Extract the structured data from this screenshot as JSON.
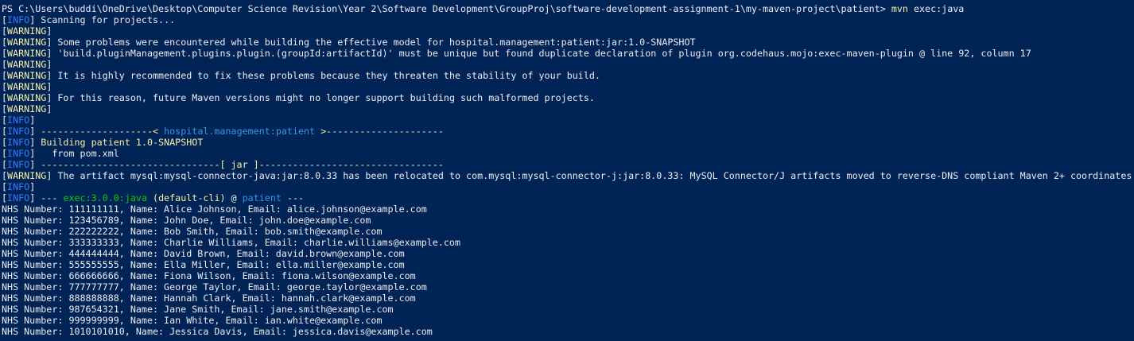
{
  "colors": {
    "background": "#012456",
    "default": "#eeedf0",
    "warning": "#f9f1a5",
    "info": "#3b78ff",
    "cyan": "#3a96dd",
    "green": "#16c60c"
  },
  "lines": [
    [
      {
        "t": "PS C:\\Users\\buddi\\OneDrive\\Desktop\\Computer Science Revision\\Year 2\\Software Development\\GroupProj\\software-development-assignment-1\\my-maven-project\\patient> ",
        "c": "default"
      },
      {
        "t": "mvn",
        "c": "yellow"
      },
      {
        "t": " exec:java",
        "c": "default"
      }
    ],
    [
      {
        "t": "[",
        "c": "default"
      },
      {
        "t": "INFO",
        "c": "info"
      },
      {
        "t": "] Scanning for projects...",
        "c": "default"
      }
    ],
    [
      {
        "t": "[",
        "c": "default"
      },
      {
        "t": "WARNING",
        "c": "warn"
      },
      {
        "t": "]",
        "c": "default"
      }
    ],
    [
      {
        "t": "[",
        "c": "default"
      },
      {
        "t": "WARNING",
        "c": "warn"
      },
      {
        "t": "] Some problems were encountered while building the effective model for hospital.management:patient:jar:1.0-SNAPSHOT",
        "c": "default"
      }
    ],
    [
      {
        "t": "[",
        "c": "default"
      },
      {
        "t": "WARNING",
        "c": "warn"
      },
      {
        "t": "] 'build.pluginManagement.plugins.plugin.(groupId:artifactId)' must be unique but found duplicate declaration of plugin org.codehaus.mojo:exec-maven-plugin @ line 92, column 17",
        "c": "default"
      }
    ],
    [
      {
        "t": "[",
        "c": "default"
      },
      {
        "t": "WARNING",
        "c": "warn"
      },
      {
        "t": "]",
        "c": "default"
      }
    ],
    [
      {
        "t": "[",
        "c": "default"
      },
      {
        "t": "WARNING",
        "c": "warn"
      },
      {
        "t": "] It is highly recommended to fix these problems because they threaten the stability of your build.",
        "c": "default"
      }
    ],
    [
      {
        "t": "[",
        "c": "default"
      },
      {
        "t": "WARNING",
        "c": "warn"
      },
      {
        "t": "]",
        "c": "default"
      }
    ],
    [
      {
        "t": "[",
        "c": "default"
      },
      {
        "t": "WARNING",
        "c": "warn"
      },
      {
        "t": "] For this reason, future Maven versions might no longer support building such malformed projects.",
        "c": "default"
      }
    ],
    [
      {
        "t": "[",
        "c": "default"
      },
      {
        "t": "WARNING",
        "c": "warn"
      },
      {
        "t": "]",
        "c": "default"
      }
    ],
    [
      {
        "t": "[",
        "c": "default"
      },
      {
        "t": "INFO",
        "c": "info"
      },
      {
        "t": "]",
        "c": "default"
      }
    ],
    [
      {
        "t": "[",
        "c": "default"
      },
      {
        "t": "INFO",
        "c": "info"
      },
      {
        "t": "] ",
        "c": "default"
      },
      {
        "t": "--------------------< ",
        "c": "yellow"
      },
      {
        "t": "hospital.management:patient",
        "c": "cyan"
      },
      {
        "t": " >---------------------",
        "c": "yellow"
      }
    ],
    [
      {
        "t": "[",
        "c": "default"
      },
      {
        "t": "INFO",
        "c": "info"
      },
      {
        "t": "] ",
        "c": "default"
      },
      {
        "t": "Building patient 1.0-SNAPSHOT",
        "c": "yellow"
      }
    ],
    [
      {
        "t": "[",
        "c": "default"
      },
      {
        "t": "INFO",
        "c": "info"
      },
      {
        "t": "]   from pom.xml",
        "c": "default"
      }
    ],
    [
      {
        "t": "[",
        "c": "default"
      },
      {
        "t": "INFO",
        "c": "info"
      },
      {
        "t": "] ",
        "c": "default"
      },
      {
        "t": "--------------------------------[ jar ]---------------------------------",
        "c": "yellow"
      }
    ],
    [
      {
        "t": "[",
        "c": "default"
      },
      {
        "t": "WARNING",
        "c": "warn"
      },
      {
        "t": "] The artifact mysql:mysql-connector-java:jar:8.0.33 has been relocated to com.mysql:mysql-connector-j:jar:8.0.33: MySQL Connector/J artifacts moved to reverse-DNS compliant Maven 2+ coordinates.",
        "c": "default"
      }
    ],
    [
      {
        "t": "[",
        "c": "default"
      },
      {
        "t": "INFO",
        "c": "info"
      },
      {
        "t": "]",
        "c": "default"
      }
    ],
    [
      {
        "t": "[",
        "c": "default"
      },
      {
        "t": "INFO",
        "c": "info"
      },
      {
        "t": "] ",
        "c": "default"
      },
      {
        "t": "--- ",
        "c": "yellow"
      },
      {
        "t": "exec:3.0.0:java",
        "c": "green"
      },
      {
        "t": " (default-cli)",
        "c": "yellow"
      },
      {
        "t": " @ ",
        "c": "default"
      },
      {
        "t": "patient",
        "c": "cyan"
      },
      {
        "t": " ---",
        "c": "yellow"
      }
    ],
    [
      {
        "t": "NHS Number: 111111111, Name: Alice Johnson, Email: alice.johnson@example.com",
        "c": "default"
      }
    ],
    [
      {
        "t": "NHS Number: 123456789, Name: John Doe, Email: john.doe@example.com",
        "c": "default"
      }
    ],
    [
      {
        "t": "NHS Number: 222222222, Name: Bob Smith, Email: bob.smith@example.com",
        "c": "default"
      }
    ],
    [
      {
        "t": "NHS Number: 333333333, Name: Charlie Williams, Email: charlie.williams@example.com",
        "c": "default"
      }
    ],
    [
      {
        "t": "NHS Number: 444444444, Name: David Brown, Email: david.brown@example.com",
        "c": "default"
      }
    ],
    [
      {
        "t": "NHS Number: 555555555, Name: Ella Miller, Email: ella.miller@example.com",
        "c": "default"
      }
    ],
    [
      {
        "t": "NHS Number: 666666666, Name: Fiona Wilson, Email: fiona.wilson@example.com",
        "c": "default"
      }
    ],
    [
      {
        "t": "NHS Number: 777777777, Name: George Taylor, Email: george.taylor@example.com",
        "c": "default"
      }
    ],
    [
      {
        "t": "NHS Number: 888888888, Name: Hannah Clark, Email: hannah.clark@example.com",
        "c": "default"
      }
    ],
    [
      {
        "t": "NHS Number: 987654321, Name: Jane Smith, Email: jane.smith@example.com",
        "c": "default"
      }
    ],
    [
      {
        "t": "NHS Number: 999999999, Name: Ian White, Email: ian.white@example.com",
        "c": "default"
      }
    ],
    [
      {
        "t": "NHS Number: 1010101010, Name: Jessica Davis, Email: jessica.davis@example.com",
        "c": "default"
      }
    ]
  ]
}
